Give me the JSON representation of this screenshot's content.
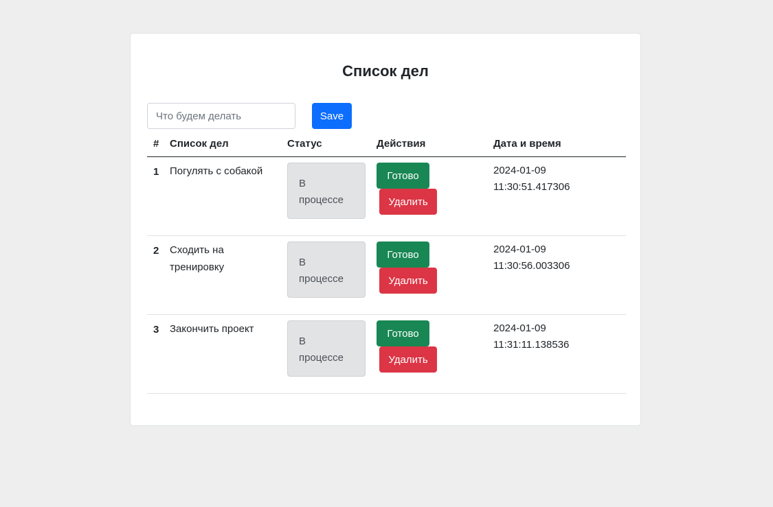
{
  "title": "Список дел",
  "form": {
    "input_placeholder": "Что будем делать",
    "input_value": "",
    "save_label": "Save"
  },
  "table": {
    "headers": {
      "num": "#",
      "task": "Список дел",
      "status": "Статус",
      "actions": "Действия",
      "datetime": "Дата и время"
    },
    "rows": [
      {
        "num": "1",
        "task": "Погулять с собакой",
        "status_line1": "В",
        "status_line2": "процессе",
        "done_label": "Готово",
        "delete_label": "Удалить",
        "date": "2024-01-09",
        "time": "11:30:51.417306"
      },
      {
        "num": "2",
        "task": "Сходить на тренировку",
        "status_line1": "В",
        "status_line2": "процессе",
        "done_label": "Готово",
        "delete_label": "Удалить",
        "date": "2024-01-09",
        "time": "11:30:56.003306"
      },
      {
        "num": "3",
        "task": "Закончить проект",
        "status_line1": "В",
        "status_line2": "процессе",
        "done_label": "Готово",
        "delete_label": "Удалить",
        "date": "2024-01-09",
        "time": "11:31:11.138536"
      }
    ]
  },
  "colors": {
    "background": "#eeeeee",
    "primary": "#0d6efd",
    "success": "#198754",
    "danger": "#dc3545",
    "status_bg": "#e2e3e5"
  }
}
